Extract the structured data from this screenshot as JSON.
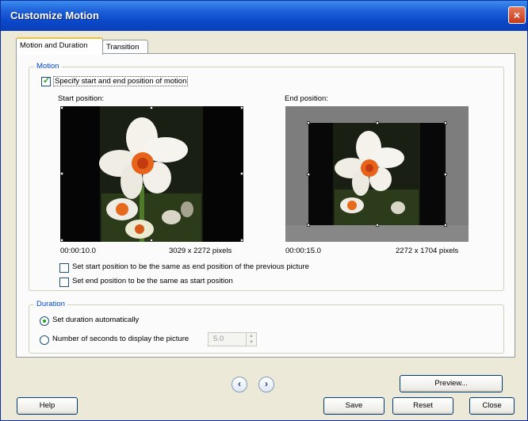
{
  "window": {
    "title": "Customize Motion",
    "close_glyph": "×"
  },
  "tabs": [
    {
      "label": "Motion and Duration",
      "active": true
    },
    {
      "label": "Transition",
      "active": false
    }
  ],
  "motion": {
    "legend": "Motion",
    "specify_label": "Specify start and end position of motion",
    "specify_checked": true,
    "start_label": "Start position:",
    "end_label": "End position:",
    "start_time": "00:00:10.0",
    "start_size": "3029 x 2272 pixels",
    "end_time": "00:00:15.0",
    "end_size": "2272 x 1704 pixels",
    "same_as_prev_label": "Set start position to be the same as end position of the previous picture",
    "same_as_start_label": "Set end position to be the same as start position"
  },
  "duration": {
    "legend": "Duration",
    "auto_label": "Set duration automatically",
    "seconds_label": "Number of seconds to display the picture",
    "seconds_value": "5.0"
  },
  "nav": {
    "prev_glyph": "‹",
    "next_glyph": "›"
  },
  "buttons": {
    "preview": "Preview...",
    "help": "Help",
    "save": "Save",
    "reset": "Reset",
    "close": "Close"
  },
  "colors": {
    "title_bar": "#0a47c9",
    "legend_text": "#0046d5",
    "dialog_bg": "#ece9d8"
  }
}
